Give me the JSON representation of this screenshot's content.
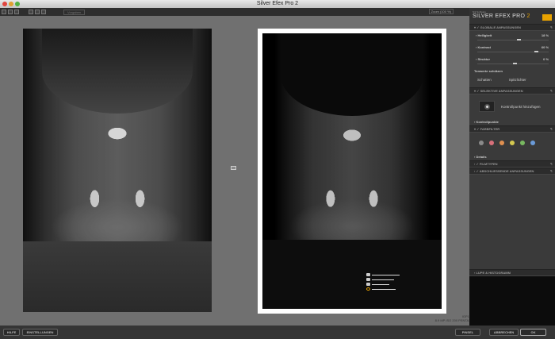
{
  "window": {
    "title": "Silver Efex Pro 2"
  },
  "toolbar": {
    "preview_label": "Vorgaben",
    "zoom": "Zoom (100 %)"
  },
  "image": {
    "filename": "IGP1852.jpg",
    "info": "8.9 MP ISO 200 PENTAX K10D"
  },
  "sidebar": {
    "brand_small": "Nik Software",
    "brand_name": "SILVER EFEX PRO",
    "brand_version": "2",
    "sections": {
      "global": "GLOBALE ANPASSUNGEN",
      "selective": "SELEKTIVE ANPASSUNGEN",
      "color_filter": "FARBFILTER",
      "film": "FILMTYPEN",
      "finishing": "ABSCHLIESSENDE ANPASSUNGEN",
      "loupe": "LUPE & HISTOGRAMM"
    },
    "sliders": [
      {
        "label": "Helligkeit",
        "value": "18",
        "unit": "%",
        "fraction": 0.55
      },
      {
        "label": "Kontrast",
        "value": "60",
        "unit": "%",
        "fraction": 0.8
      },
      {
        "label": "Struktur",
        "value": "0",
        "unit": "%",
        "fraction": 0.5
      }
    ],
    "tone": {
      "title": "Tonwerte schützen",
      "shadows": "Schatten",
      "highlights": "Spitzlichter"
    },
    "control_point": "Kontrollpunkt hinzufügen",
    "control_points": "Kontrollpunkte",
    "details": "Details",
    "filter_colors": [
      "#8a8a8a",
      "#d8707a",
      "#e09050",
      "#d4c850",
      "#78b860",
      "#6a9ad8"
    ]
  },
  "footer": {
    "help": "HILFE",
    "settings": "EINSTELLUNGEN",
    "brush": "PINSEL",
    "cancel": "ABBRECHEN",
    "ok": "OK"
  }
}
